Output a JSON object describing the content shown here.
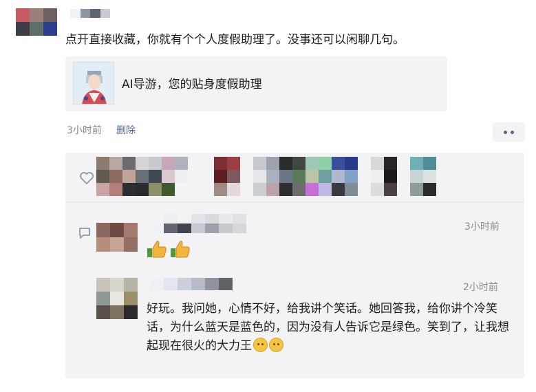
{
  "post": {
    "text": "点开直接收藏，你就有个个人度假助理了。没事还可以闲聊几句。",
    "share_card": {
      "title": "AI导游，您的贴身度假助理"
    },
    "meta": {
      "time": "3小时前",
      "delete_label": "删除"
    }
  },
  "comments": [
    {
      "time": "3小时前",
      "content_emoji": "thumbs-up-emoji x2"
    },
    {
      "time": "2小时前",
      "text": "好玩。我问她，心情不好，给我讲个笑话。她回答我，给你讲个冷笑话，为什么蓝天是蓝色的，因为没有人告诉它是绿色。笑到了，让我想起现在很火的大力王",
      "trailing_emoji": "thinking-face-emoji x2"
    }
  ],
  "icons": {
    "like": "heart-outline-icon",
    "comment": "comment-bubble-icon",
    "more": "more-dots-icon"
  },
  "colors": {
    "link": "#56678f",
    "panel": "#f3f3f5",
    "meta": "#888888"
  }
}
